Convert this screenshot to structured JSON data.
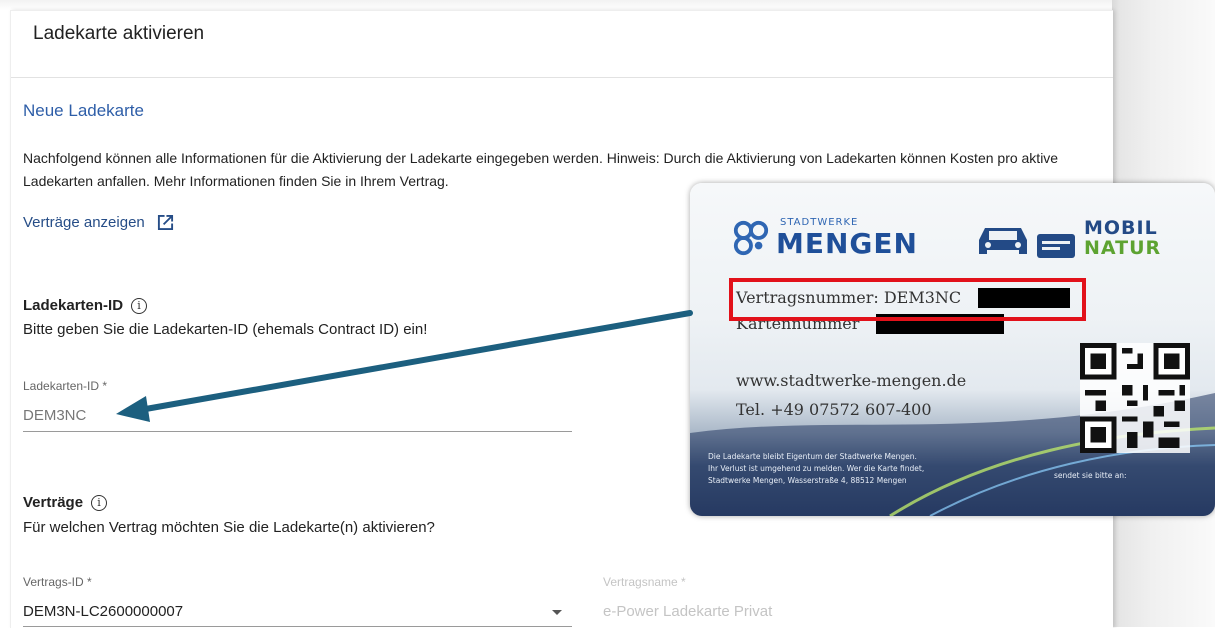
{
  "panel": {
    "title": "Ladekarte aktivieren"
  },
  "section": {
    "title": "Neue Ladekarte",
    "intro": "Nachfolgend können alle Informationen für die Aktivierung der Ladekarte eingegeben werden. Hinweis: Durch die Aktivierung von Ladekarten können Kosten pro aktive Ladekarten anfallen. Mehr Informationen finden Sie in Ihrem Vertrag.",
    "contracts_link": "Verträge anzeigen"
  },
  "card_id_block": {
    "heading": "Ladekarten-ID",
    "help": "Bitte geben Sie die Ladekarten-ID (ehemals Contract ID) ein!",
    "field_label": "Ladekarten-ID *",
    "field_value": "DEM3NC"
  },
  "contracts_block": {
    "heading": "Verträge",
    "help": "Für welchen Vertrag möchten Sie die Ladekarte(n) aktivieren?",
    "contract_id_label": "Vertrags-ID *",
    "contract_id_value": "DEM3N-LC2600000007",
    "contract_name_label": "Vertragsname *",
    "contract_name_value": "e-Power Ladekarte Privat"
  },
  "charging_card": {
    "brand_small": "STADTWERKE",
    "brand_big": "MENGEN",
    "mobil": "MOBIL",
    "natur": "NATUR",
    "contract_number": "Vertragsnummer: DEM3NC",
    "card_number": "Kartennummer",
    "website": "www.stadtwerke-mengen.de",
    "phone": "Tel. +49 07572 607-400",
    "footer_line1": "Die Ladekarte bleibt Eigentum der Stadtwerke Mengen.",
    "footer_line2": "Ihr Verlust ist umgehend zu melden. Wer die Karte findet,",
    "footer_line3": "Stadtwerke Mengen, Wasserstraße 4, 88512 Mengen",
    "footer_right": "sendet sie bitte an:"
  },
  "colors": {
    "link_blue": "#264d87",
    "section_blue": "#2e5ea8",
    "highlight_red": "#e2111a",
    "arrow_teal": "#1c5f7f"
  },
  "icons": [
    "external-link-icon",
    "info-icon",
    "dropdown-arrow-icon",
    "car-icon",
    "qr-code"
  ]
}
